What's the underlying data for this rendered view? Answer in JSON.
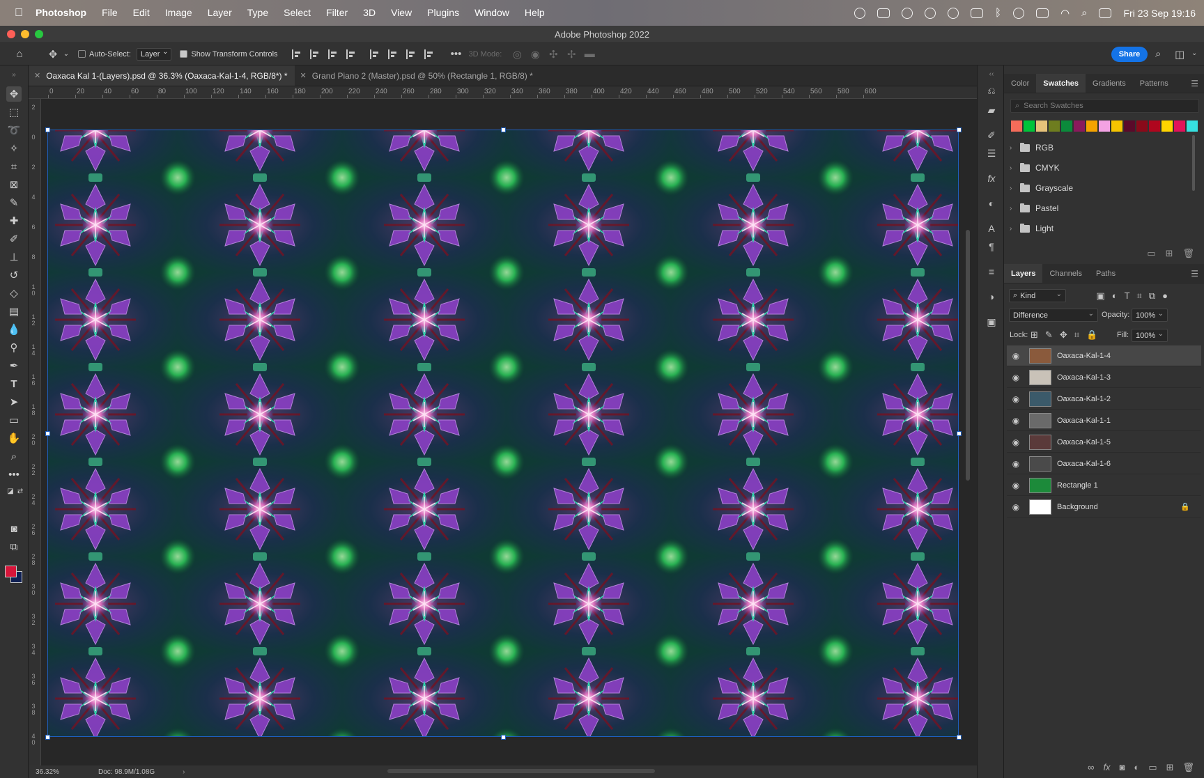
{
  "menubar": {
    "items": [
      "Photoshop",
      "File",
      "Edit",
      "Image",
      "Layer",
      "Type",
      "Select",
      "Filter",
      "3D",
      "View",
      "Plugins",
      "Window",
      "Help"
    ],
    "clock": "Fri 23 Sep  19:16"
  },
  "window": {
    "title": "Adobe Photoshop 2022"
  },
  "options": {
    "auto_select_label": "Auto-Select:",
    "auto_select_value": "Layer",
    "show_transform_label": "Show Transform Controls",
    "mode_3d_label": "3D Mode:",
    "share_label": "Share"
  },
  "tabs": [
    {
      "label": "Oaxaca Kal 1-(Layers).psd @ 36.3% (Oaxaca-Kal-1-4, RGB/8*) *",
      "active": true
    },
    {
      "label": "Grand Piano 2 (Master).psd @ 50% (Rectangle 1, RGB/8) *",
      "active": false
    }
  ],
  "ruler": {
    "top_labels": [
      "0",
      "20",
      "40",
      "60",
      "80",
      "100",
      "120",
      "140",
      "160",
      "180",
      "200",
      "220",
      "240",
      "260",
      "280",
      "300",
      "320",
      "340",
      "360",
      "380",
      "400",
      "420",
      "440",
      "460",
      "480",
      "500",
      "520",
      "540",
      "560",
      "580",
      "600"
    ],
    "left_labels": [
      "2",
      "0",
      "2",
      "4",
      "6",
      "8",
      "10",
      "12",
      "14",
      "16",
      "18",
      "20",
      "22",
      "24",
      "26",
      "28",
      "30",
      "32",
      "34",
      "36",
      "38",
      "40"
    ]
  },
  "status": {
    "zoom": "36.32%",
    "doc": "Doc: 98.9M/1.08G"
  },
  "colors": {
    "foreground": "#d7153a",
    "background": "#0e1f52",
    "accent": "#1473e6"
  },
  "swatches_panel": {
    "tabs": [
      "Color",
      "Swatches",
      "Gradients",
      "Patterns"
    ],
    "active_tab": "Swatches",
    "search_placeholder": "Search Swatches",
    "swatch_colors": [
      "#f46c5a",
      "#00c43a",
      "#e6c27a",
      "#6e7d1f",
      "#0b8a3b",
      "#8a1a5c",
      "#f5a300",
      "#f3a2e3",
      "#f5c400",
      "#5a0a2a",
      "#8a0a1a",
      "#b0061e",
      "#ffd400",
      "#e0125a",
      "#36e0e0"
    ],
    "groups": [
      "RGB",
      "CMYK",
      "Grayscale",
      "Pastel",
      "Light"
    ]
  },
  "layers_panel": {
    "tabs": [
      "Layers",
      "Channels",
      "Paths"
    ],
    "active_tab": "Layers",
    "filter_kind": "Kind",
    "blend_mode": "Difference",
    "opacity_label": "Opacity:",
    "opacity_value": "100%",
    "lock_label": "Lock:",
    "fill_label": "Fill:",
    "fill_value": "100%",
    "layers": [
      {
        "name": "Oaxaca-Kal-1-4",
        "selected": true,
        "thumb": "#8a5a3c"
      },
      {
        "name": "Oaxaca-Kal-1-3",
        "selected": false,
        "thumb": "#c9c2b8"
      },
      {
        "name": "Oaxaca-Kal-1-2",
        "selected": false,
        "thumb": "#3b5a6a"
      },
      {
        "name": "Oaxaca-Kal-1-1",
        "selected": false,
        "thumb": "#6a6a6a"
      },
      {
        "name": "Oaxaca-Kal-1-5",
        "selected": false,
        "thumb": "#5a3a3a"
      },
      {
        "name": "Oaxaca-Kal-1-6",
        "selected": false,
        "thumb": "#4a4a4a"
      },
      {
        "name": "Rectangle 1",
        "selected": false,
        "thumb": "#1c8a3a"
      },
      {
        "name": "Background",
        "selected": false,
        "thumb": "#ffffff",
        "locked": true
      }
    ]
  }
}
